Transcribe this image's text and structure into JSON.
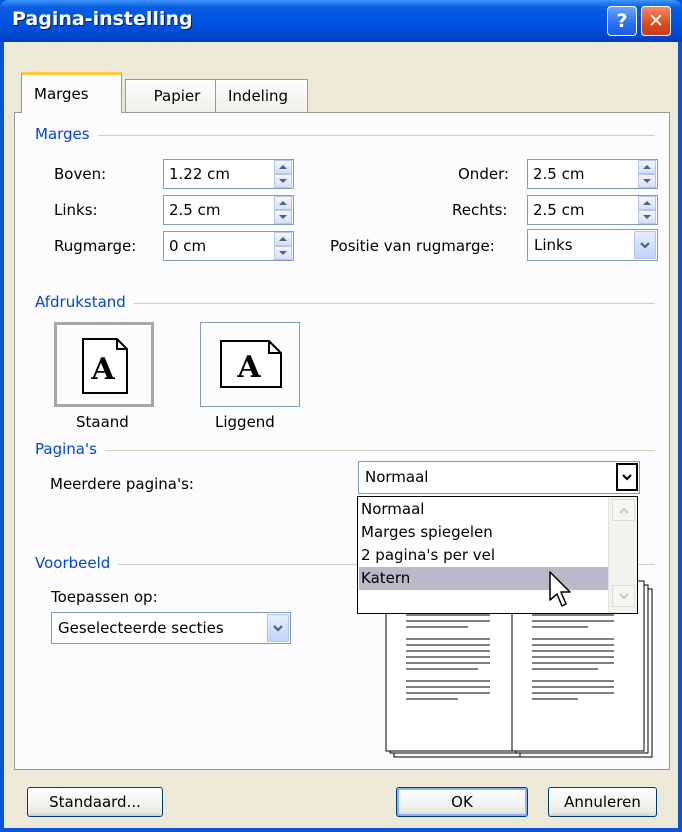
{
  "window": {
    "title": "Pagina-instelling",
    "help_label": "?",
    "close_label": "✕"
  },
  "tabs": [
    {
      "label": "Marges"
    },
    {
      "label": "Papier"
    },
    {
      "label": "Indeling"
    }
  ],
  "margins": {
    "group_label": "Marges",
    "top": {
      "label": "Boven:",
      "value": "1.22 cm"
    },
    "bottom": {
      "label": "Onder:",
      "value": "2.5 cm"
    },
    "left": {
      "label": "Links:",
      "value": "2.5 cm"
    },
    "right": {
      "label": "Rechts:",
      "value": "2.5 cm"
    },
    "gutter": {
      "label": "Rugmarge:",
      "value": "0 cm"
    },
    "gutter_position": {
      "label": "Positie van rugmarge:",
      "value": "Links"
    }
  },
  "orientation": {
    "group_label": "Afdrukstand",
    "portrait_label": "Staand",
    "landscape_label": "Liggend",
    "icon_glyph": "A"
  },
  "pages": {
    "group_label": "Pagina's",
    "multiple_label": "Meerdere pagina's:",
    "selected": "Normaal",
    "options": [
      "Normaal",
      "Marges spiegelen",
      "2 pagina's per vel",
      "Katern"
    ],
    "highlighted_option": "Katern"
  },
  "preview": {
    "group_label": "Voorbeeld",
    "apply_label": "Toepassen op:",
    "apply_value": "Geselecteerde secties"
  },
  "buttons": {
    "default_label": "Standaard...",
    "ok_label": "OK",
    "cancel_label": "Annuleren"
  },
  "colors": {
    "titlebar": "#0054e3",
    "group_label": "#0046d5",
    "dialog_bg": "#ece9d8",
    "tab_accent": "#ffc83c"
  }
}
